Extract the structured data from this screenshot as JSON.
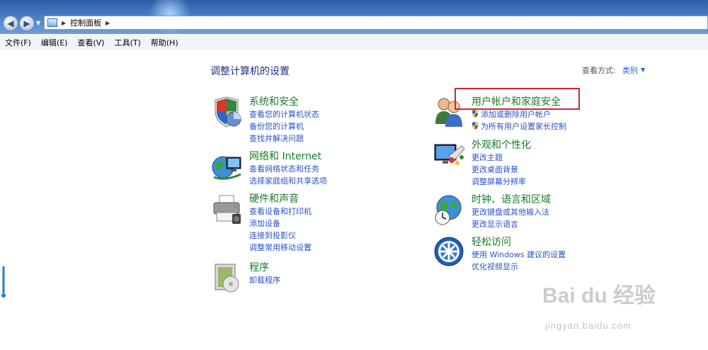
{
  "address": {
    "path": "控制面板"
  },
  "menu": [
    "文件(F)",
    "编辑(E)",
    "查看(V)",
    "工具(T)",
    "帮助(H)"
  ],
  "main": {
    "title": "调整计算机的设置",
    "view_by_label": "查看方式:",
    "view_by_value": "类别"
  },
  "categories": {
    "system": {
      "title": "系统和安全",
      "icon": "shield-pie-icon",
      "links": [
        "查看您的计算机状态",
        "备份您的计算机",
        "查找并解决问题"
      ]
    },
    "network": {
      "title": "网络和 Internet",
      "icon": "network-globe-icon",
      "links": [
        "查看网络状态和任务",
        "选择家庭组和共享选项"
      ]
    },
    "hardware": {
      "title": "硬件和声音",
      "icon": "printer-icon",
      "links": [
        "查看设备和打印机",
        "添加设备",
        "连接到投影仪",
        "调整常用移动设置"
      ]
    },
    "programs": {
      "title": "程序",
      "icon": "program-box-icon",
      "links": [
        "卸载程序"
      ]
    },
    "users": {
      "title": "用户帐户和家庭安全",
      "icon": "users-icon",
      "links": [
        "添加或删除用户帐户",
        "为所有用户设置家长控制"
      ]
    },
    "appearance": {
      "title": "外观和个性化",
      "icon": "monitor-palette-icon",
      "links": [
        "更改主题",
        "更改桌面背景",
        "调整屏幕分辨率"
      ]
    },
    "clock": {
      "title": "时钟、语言和区域",
      "icon": "clock-globe-icon",
      "links": [
        "更改键盘或其他输入法",
        "更改显示语言"
      ]
    },
    "ease": {
      "title": "轻松访问",
      "icon": "ease-of-access-icon",
      "links": [
        "使用 Windows 建议的设置",
        "优化视频显示"
      ]
    }
  },
  "watermark": {
    "logo": "Bai du 经验",
    "url": "jingyan.baidu.com"
  },
  "colors": {
    "category_title": "#197a29",
    "link": "#2a52c8",
    "highlight": "#d2252c"
  }
}
